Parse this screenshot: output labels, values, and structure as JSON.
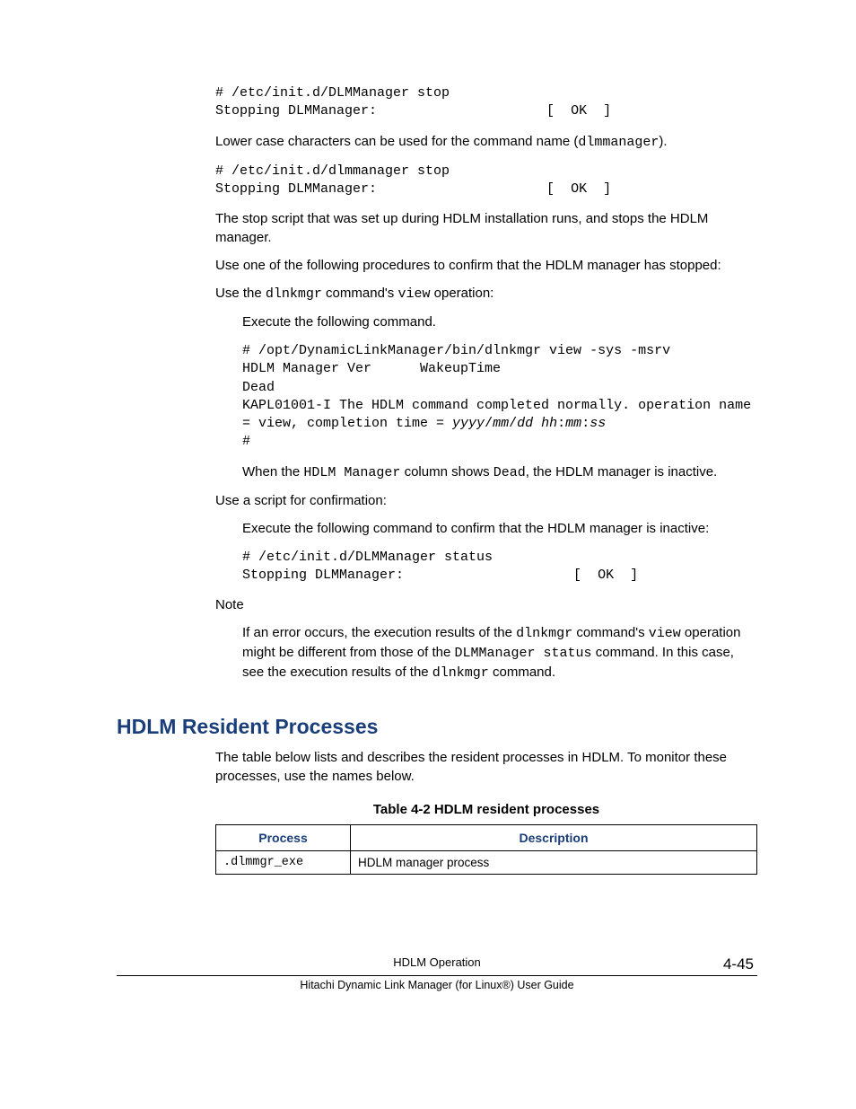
{
  "blocks": {
    "cmd1_l1": "# /etc/init.d/DLMManager stop",
    "cmd1_l2": "Stopping DLMManager:                     [  OK  ]",
    "para_lower": "Lower case characters can be used for the command name (",
    "para_lower_mono": "dlmmanager",
    "para_lower_end": ").",
    "cmd2_l1": "# /etc/init.d/dlmmanager stop",
    "cmd2_l2": "Stopping DLMManager:                     [  OK  ]",
    "para_stopscript": "The stop script that was set up during HDLM installation runs, and stops the HDLM manager.",
    "para_confirm": "Use one of the following procedures to confirm that the HDLM manager has stopped:",
    "use_dlnkmgr_pre": "Use the ",
    "use_dlnkmgr_m1": "dlnkmgr",
    "use_dlnkmgr_mid": " command's ",
    "use_dlnkmgr_m2": "view",
    "use_dlnkmgr_post": " operation:",
    "exec_following": "Execute the following command.",
    "cmd3_l1": "# /opt/DynamicLinkManager/bin/dlnkmgr view -sys -msrv",
    "cmd3_l2": "HDLM Manager Ver      WakeupTime",
    "cmd3_l3": "Dead",
    "cmd3_l4a": "KAPL01001-I The HDLM command completed normally. operation name ",
    "cmd3_l4b": "= view, completion time = ",
    "cmd3_ital": "yyyy",
    "cmd3_sl1": "/",
    "cmd3_ital2": "mm",
    "cmd3_sl2": "/",
    "cmd3_ital3": "dd",
    "cmd3_sp": " ",
    "cmd3_ital4": "hh",
    "cmd3_c1": ":",
    "cmd3_ital5": "mm",
    "cmd3_c2": ":",
    "cmd3_ital6": "ss",
    "cmd3_l6": "#",
    "para_when_pre": "When the ",
    "para_when_m1": "HDLM Manager",
    "para_when_mid": " column shows ",
    "para_when_m2": "Dead",
    "para_when_post": ", the HDLM manager is inactive.",
    "use_script": "Use a script for confirmation:",
    "exec_confirm_inactive": "Execute the following command to confirm that the HDLM manager is inactive:",
    "cmd4_l1": "# /etc/init.d/DLMManager status",
    "cmd4_l2": "Stopping DLMManager:                     [  OK  ]",
    "note_label": "Note",
    "note_p1": "If an error occurs, the execution results of the ",
    "note_m1": "dlnkmgr",
    "note_p2": " command's ",
    "note_m2": "view",
    "note_p3": " operation might be different from those of the ",
    "note_m3": "DLMManager status",
    "note_p4": " command. In this case, see the execution results of the ",
    "note_m4": "dlnkmgr",
    "note_p5": " command."
  },
  "heading": "HDLM Resident Processes",
  "heading_para": "The table below lists and describes the resident processes in HDLM. To monitor these processes, use the names below.",
  "table": {
    "caption": "Table 4-2 HDLM resident processes",
    "headers": {
      "col1": "Process",
      "col2": "Description"
    },
    "rows": [
      {
        "process": ".dlmmgr_exe",
        "desc": "HDLM manager process"
      }
    ]
  },
  "footer": {
    "section": "HDLM Operation",
    "page": "4-45",
    "doc": "Hitachi Dynamic Link Manager (for Linux®) User Guide"
  }
}
